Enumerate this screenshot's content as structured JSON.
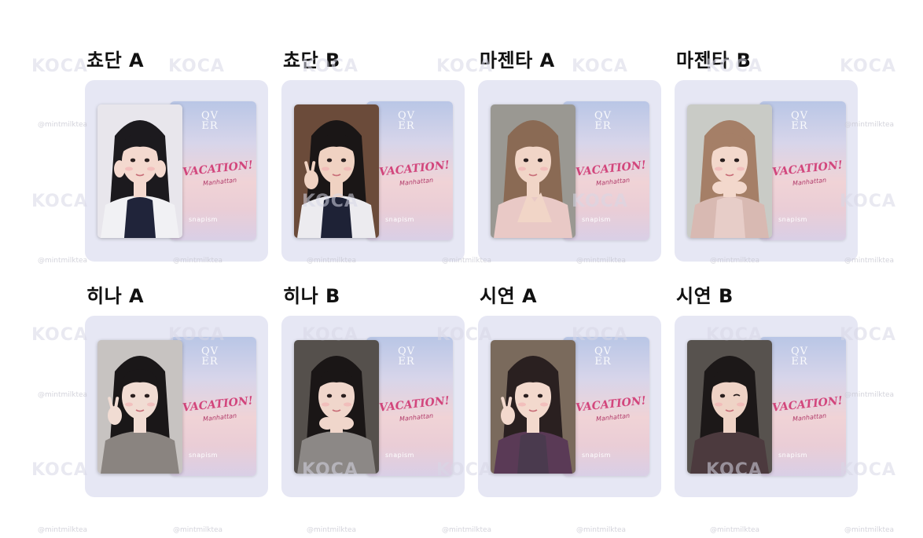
{
  "watermark": {
    "brand": "KOCA",
    "handle": "@mintmilktea"
  },
  "card_back": {
    "logo": "QV\nER",
    "title": "VACATION!",
    "subtitle": "Manhattan",
    "brand": "snapism"
  },
  "cards": [
    {
      "label": "쵸단 A",
      "photo": {
        "bg": "#e8e6ec",
        "hair": "#1c1a1e",
        "skin": "#f4d9cf",
        "top": "#20243a",
        "outer": "#f1f1f4",
        "pose": "cheek"
      }
    },
    {
      "label": "쵸단 B",
      "photo": {
        "bg": "#6b4b3a",
        "hair": "#1a1616",
        "skin": "#f0d2c2",
        "top": "#1e2236",
        "outer": "#ecebef",
        "pose": "peace"
      }
    },
    {
      "label": "마젠타 A",
      "photo": {
        "bg": "#9a9892",
        "hair": "#8a6a54",
        "skin": "#f1d5c7",
        "top": "#e9c9c6",
        "outer": "#e9c9c6",
        "pose": "heart"
      }
    },
    {
      "label": "마젠타 B",
      "photo": {
        "bg": "#c9cbc6",
        "hair": "#a57f67",
        "skin": "#f3d8cc",
        "top": "#e7cdc8",
        "outer": "#d8b9b2",
        "pose": "chin"
      }
    },
    {
      "label": "히나 A",
      "photo": {
        "bg": "#c7c3c1",
        "hair": "#1a1718",
        "skin": "#f1dcd3",
        "top": "#8a8480",
        "outer": "#8a8480",
        "pose": "peace"
      }
    },
    {
      "label": "히나 B",
      "photo": {
        "bg": "#55504c",
        "hair": "#1a1616",
        "skin": "#f0d6cb",
        "top": "#8c8886",
        "outer": "#8c8886",
        "pose": "chin"
      }
    },
    {
      "label": "시연 A",
      "photo": {
        "bg": "#7a6a5c",
        "hair": "#2a2020",
        "skin": "#f3d9cd",
        "top": "#4a3a4e",
        "outer": "#5a3a56",
        "pose": "peace"
      }
    },
    {
      "label": "시연 B",
      "photo": {
        "bg": "#57524e",
        "hair": "#1c1818",
        "skin": "#efd3c6",
        "top": "#4c3a3e",
        "outer": "#4c3a3e",
        "pose": "wink"
      }
    }
  ]
}
